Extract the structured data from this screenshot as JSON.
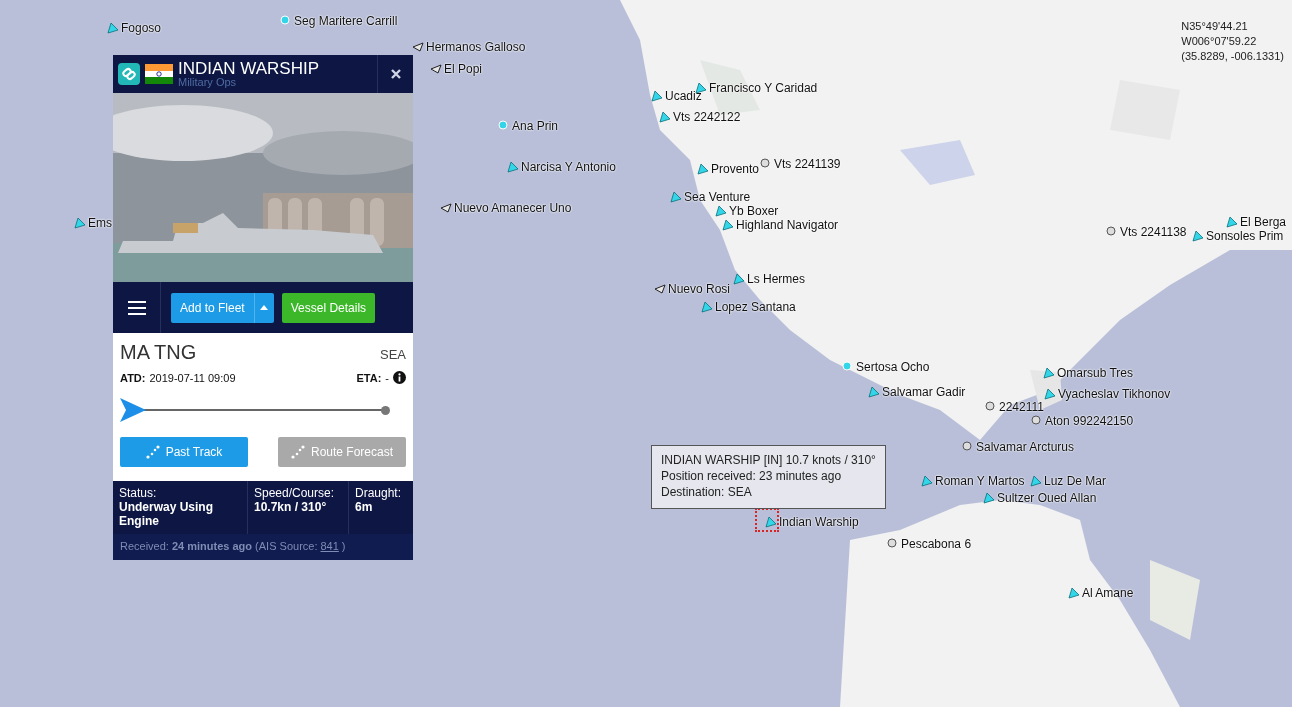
{
  "map": {
    "coordinates": [
      "N35°49'44.21",
      "W006°07'59.22",
      "(35.8289, -006.1331)"
    ],
    "vessels": [
      {
        "name": "Fogoso",
        "kind": "ship",
        "selected": false
      },
      {
        "name": "Seg Maritere Carrill",
        "kind": "station",
        "selected": false
      },
      {
        "name": "Hermanos Galloso",
        "kind": "idle",
        "selected": false
      },
      {
        "name": "El Popi",
        "kind": "idle",
        "selected": false
      },
      {
        "name": "Ucadiz",
        "kind": "ship",
        "selected": false
      },
      {
        "name": "Francisco Y Caridad",
        "kind": "ship",
        "selected": false
      },
      {
        "name": "Vts 2242122",
        "kind": "ship",
        "selected": false
      },
      {
        "name": "Ana Prin",
        "kind": "station",
        "selected": false
      },
      {
        "name": "Narcisa Y Antonio",
        "kind": "ship",
        "selected": false
      },
      {
        "name": "Provento",
        "kind": "ship",
        "selected": false
      },
      {
        "name": "Vts 2241139",
        "kind": "beacon",
        "selected": false
      },
      {
        "name": "Nuevo Amanecer Uno",
        "kind": "idle",
        "selected": false
      },
      {
        "name": "Ems",
        "kind": "ship",
        "selected": false
      },
      {
        "name": "Sea Venture",
        "kind": "ship",
        "selected": false
      },
      {
        "name": "Yb Boxer",
        "kind": "ship",
        "selected": false
      },
      {
        "name": "Highland Navigator",
        "kind": "ship",
        "selected": false
      },
      {
        "name": "Ls Hermes",
        "kind": "ship",
        "selected": false
      },
      {
        "name": "Nuevo Rosi",
        "kind": "idle",
        "selected": false
      },
      {
        "name": "Lopez Santana",
        "kind": "ship",
        "selected": false
      },
      {
        "name": "Sertosa Ocho",
        "kind": "station",
        "selected": false
      },
      {
        "name": "Salvamar Gadir",
        "kind": "ship",
        "selected": false
      },
      {
        "name": "Omarsub Tres",
        "kind": "ship",
        "selected": false
      },
      {
        "name": "Vyacheslav Tikhonov",
        "kind": "ship",
        "selected": false
      },
      {
        "name": "2242111",
        "kind": "beacon",
        "selected": false
      },
      {
        "name": "Aton 992242150",
        "kind": "beacon",
        "selected": false
      },
      {
        "name": "Salvamar Arcturus",
        "kind": "beacon",
        "selected": false
      },
      {
        "name": "Roman Y Martos",
        "kind": "ship",
        "selected": false
      },
      {
        "name": "Luz De Mar",
        "kind": "ship",
        "selected": false
      },
      {
        "name": "Sultzer Oued Allan",
        "kind": "ship",
        "selected": false
      },
      {
        "name": "Indian Warship",
        "kind": "ship",
        "selected": true
      },
      {
        "name": "Pescabona 6",
        "kind": "beacon",
        "selected": false
      },
      {
        "name": "Al Amane",
        "kind": "ship",
        "selected": false
      },
      {
        "name": "Vts 2241138",
        "kind": "beacon",
        "selected": false
      },
      {
        "name": "Sonsoles Prim",
        "kind": "ship",
        "selected": false
      },
      {
        "name": "El Berga",
        "kind": "ship",
        "selected": false
      }
    ],
    "tooltip": [
      "INDIAN WARSHIP [IN] 10.7 knots / 310°",
      "Position received: 23 minutes ago",
      "Destination: SEA"
    ]
  },
  "panel": {
    "title": "INDIAN WARSHIP",
    "subtitle": "Military Ops",
    "add_to_fleet": "Add to Fleet",
    "vessel_details": "Vessel Details",
    "destination": "MA TNG",
    "destination_code": "SEA",
    "atd_label": "ATD:",
    "atd": "2019-07-11 09:09",
    "eta_label": "ETA:",
    "eta": "-",
    "voyage": {
      "level": 0
    },
    "actions": [
      {
        "label": "Past Track",
        "disabled": false
      },
      {
        "label": "Route Forecast",
        "disabled": true
      }
    ],
    "stats": [
      {
        "label": "Status:",
        "value": "Underway Using Engine"
      },
      {
        "label": "Speed/Course:",
        "value": "10.7kn / 310°"
      },
      {
        "label": "Draught:",
        "value": "6m"
      }
    ],
    "received": "Received: **24 minutes ago** (AIS Source:",
    "source": "841",
    "received_end": ")"
  }
}
